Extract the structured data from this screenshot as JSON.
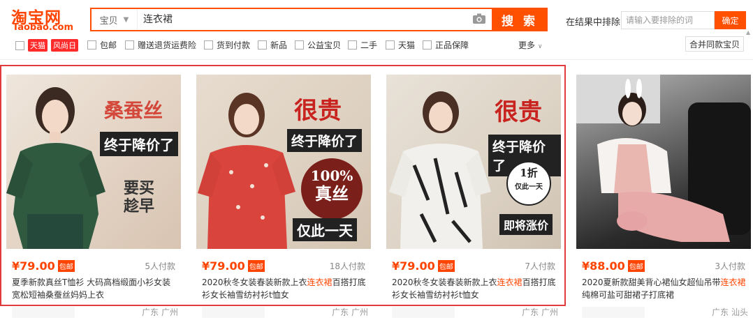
{
  "logo": {
    "cn": "淘宝网",
    "en": "Taobao.com"
  },
  "search": {
    "type_label": "宝贝",
    "query": "连衣裙",
    "button": "搜 索"
  },
  "exclude": {
    "label": "在结果中排除",
    "placeholder": "请输入要排除的词",
    "button": "确定"
  },
  "filters": {
    "tmall": "天猫",
    "fengshangri": "风尚日",
    "items": [
      "包邮",
      "赠送退货运费险",
      "货到付款",
      "新品",
      "公益宝贝",
      "二手",
      "天猫",
      "正品保障"
    ],
    "more": "更多",
    "merge": "合并同款宝贝"
  },
  "products": [
    {
      "price": "¥79.00",
      "baoyou": "包邮",
      "paid": "5人付款",
      "title_a": "夏季新款真丝T恤衫 大码高档缎面小衫女装宽松短袖桑蚕丝妈妈上衣",
      "title_hl": "",
      "title_b": "",
      "location": "广东 广州",
      "ad1": "桑蚕丝",
      "ad2": "终于降价了",
      "ad3": "要买",
      "ad4": "趁早"
    },
    {
      "price": "¥79.00",
      "baoyou": "包邮",
      "paid": "18人付款",
      "title_a": "2020秋冬女装春装新款上衣",
      "title_hl": "连衣裙",
      "title_b": "百搭打底衫女长袖雪纺衬衫t恤女",
      "location": "广东 广州",
      "ad1": "很贵",
      "ad2": "终于降价了",
      "ad3": "100%",
      "ad4": "真丝",
      "ad5": "仅此一天"
    },
    {
      "price": "¥79.00",
      "baoyou": "包邮",
      "paid": "7人付款",
      "title_a": "2020秋冬女装春装新款上衣",
      "title_hl": "连衣裙",
      "title_b": "百搭打底衫女长袖雪纺衬衫t恤女",
      "location": "广东 广州",
      "ad1": "很贵",
      "ad2": "终于降价了",
      "ad3": "1折",
      "ad4": "仅此一天",
      "ad5": "即将涨价"
    },
    {
      "price": "¥88.00",
      "baoyou": "包邮",
      "paid": "3人付款",
      "title_a": "2020夏新款甜美背心裙仙女超仙吊带",
      "title_hl": "连衣裙",
      "title_b": "纯棉可盐可甜裙子打底裙",
      "location": "广东 汕头"
    }
  ],
  "colors": {
    "accent": "#ff5000",
    "highlight": "#e23b3b"
  }
}
